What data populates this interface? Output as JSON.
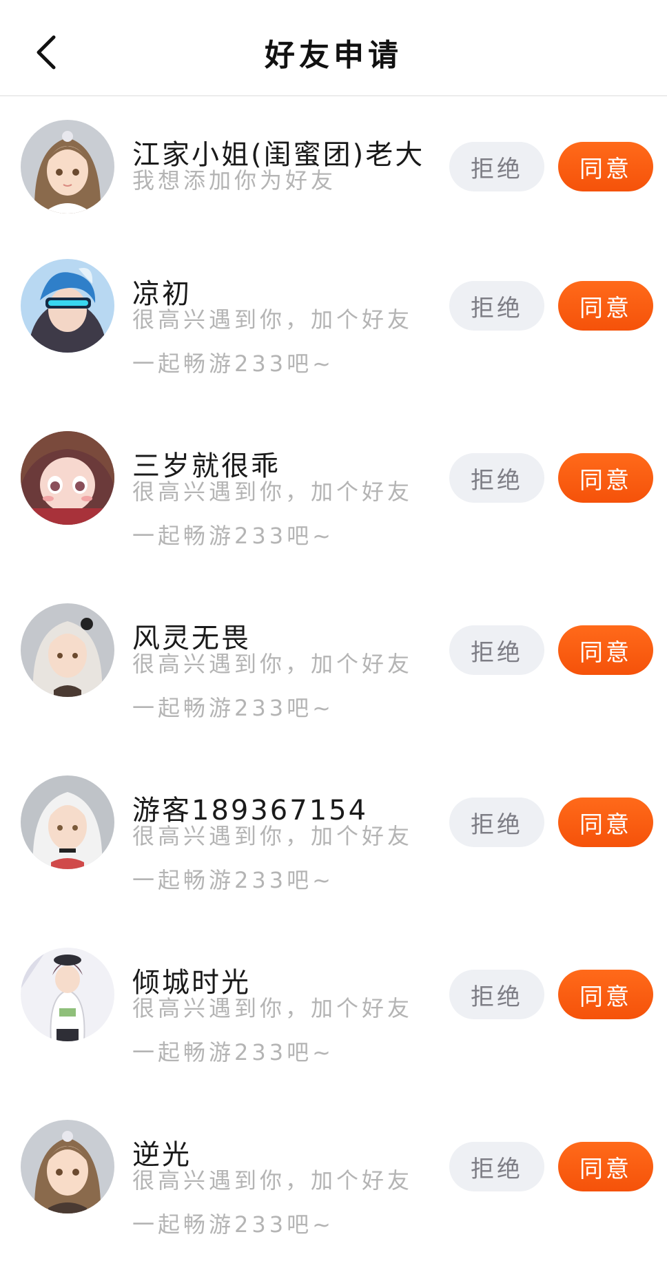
{
  "header": {
    "title": "好友申请",
    "back_icon": "chevron-left-icon"
  },
  "colors": {
    "accent": "#f85b0f",
    "reject_bg": "#eef0f4",
    "reject_text": "#7d7d85",
    "secondary_text": "#b4b4b4"
  },
  "buttons": {
    "reject_label": "拒绝",
    "accept_label": "同意"
  },
  "requests": [
    {
      "name": "江家小姐(闺蜜团)老大",
      "message": "我想添加你为好友"
    },
    {
      "name": "凉初",
      "message": "很高兴遇到你，加个好友一起畅游233吧~"
    },
    {
      "name": "三岁就很乖",
      "message": "很高兴遇到你，加个好友一起畅游233吧~"
    },
    {
      "name": "风灵无畏",
      "message": "很高兴遇到你，加个好友一起畅游233吧~"
    },
    {
      "name": "游客189367154",
      "message": "很高兴遇到你，加个好友一起畅游233吧~"
    },
    {
      "name": "倾城时光",
      "message": "很高兴遇到你，加个好友一起畅游233吧~"
    },
    {
      "name": "逆光",
      "message": "很高兴遇到你，加个好友一起畅游233吧~"
    }
  ]
}
